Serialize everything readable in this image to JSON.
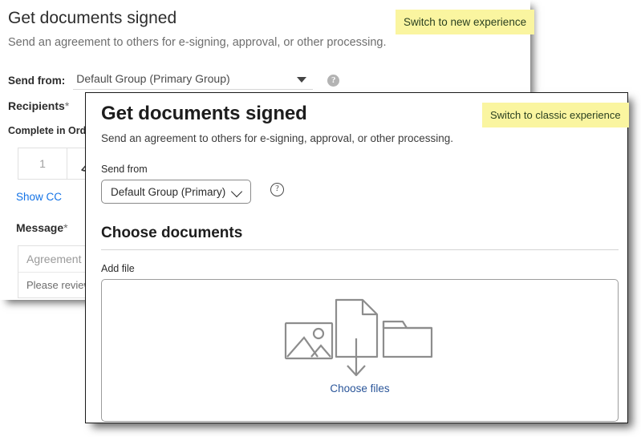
{
  "classic": {
    "title": "Get documents signed",
    "subtitle": "Send an agreement to others for e-signing, approval, or other processing.",
    "send_from_label": "Send from:",
    "send_from_value": "Default Group (Primary Group)",
    "help_glyph": "?",
    "recipients_label": "Recipients",
    "required_mark": "*",
    "complete_in_order_label": "Complete in Order",
    "recipient_order_value": "1",
    "show_cc_label": "Show CC",
    "message_label": "Message",
    "agreement_name_value": "Agreement Name",
    "message_body_value": "Please review and sign",
    "switch_button_label": "Switch to new experience"
  },
  "modal": {
    "title": "Get documents signed",
    "subtitle": "Send an agreement to others for e-signing, approval, or other processing.",
    "send_from_label": "Send from",
    "send_from_value": "Default Group (Primary)",
    "help_glyph": "?",
    "section_heading": "Choose documents",
    "add_file_label": "Add file",
    "choose_files_label": "Choose files",
    "switch_button_label": "Switch to classic experience"
  },
  "colors": {
    "highlight": "#faf5a0",
    "link": "#2a5599",
    "classic_link": "#1473e6",
    "modal_border": "#1a1a1a"
  }
}
